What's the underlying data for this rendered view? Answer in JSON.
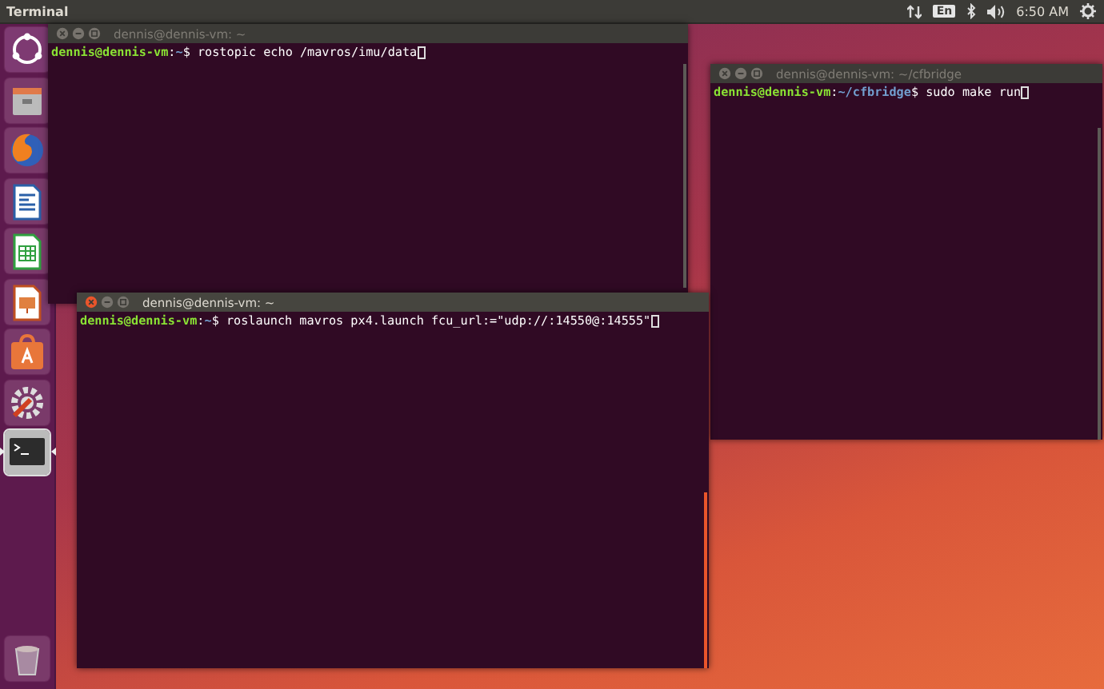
{
  "top_panel": {
    "app_title": "Terminal",
    "keyboard_layout": "En",
    "clock": "6:50 AM"
  },
  "launcher": {
    "items": [
      {
        "kind": "dash",
        "active": false
      },
      {
        "kind": "files",
        "active": false
      },
      {
        "kind": "browser",
        "active": false
      },
      {
        "kind": "writer",
        "active": false
      },
      {
        "kind": "calc",
        "active": false
      },
      {
        "kind": "impress",
        "active": false
      },
      {
        "kind": "software",
        "active": false
      },
      {
        "kind": "settings",
        "active": false
      },
      {
        "kind": "terminal",
        "active": true
      },
      {
        "kind": "trash",
        "active": false
      }
    ]
  },
  "windows": [
    {
      "title": "dennis@dennis-vm: ~",
      "focused": false,
      "lines": [
        {
          "user_host": "dennis@dennis-vm",
          "separator": ":",
          "path": "~",
          "prompt_sign": "$",
          "command": "rostopic echo /mavros/imu/data"
        }
      ]
    },
    {
      "title": "dennis@dennis-vm: ~/cfbridge",
      "focused": false,
      "lines": [
        {
          "user_host": "dennis@dennis-vm",
          "separator": ":",
          "path": "~/cfbridge",
          "prompt_sign": "$",
          "command": "sudo make run"
        }
      ]
    },
    {
      "title": "dennis@dennis-vm: ~",
      "focused": true,
      "lines": [
        {
          "user_host": "dennis@dennis-vm",
          "separator": ":",
          "path": "~",
          "prompt_sign": "$",
          "command": "roslaunch mavros px4.launch fcu_url:=\"udp://:14550@:14555\""
        }
      ]
    }
  ]
}
